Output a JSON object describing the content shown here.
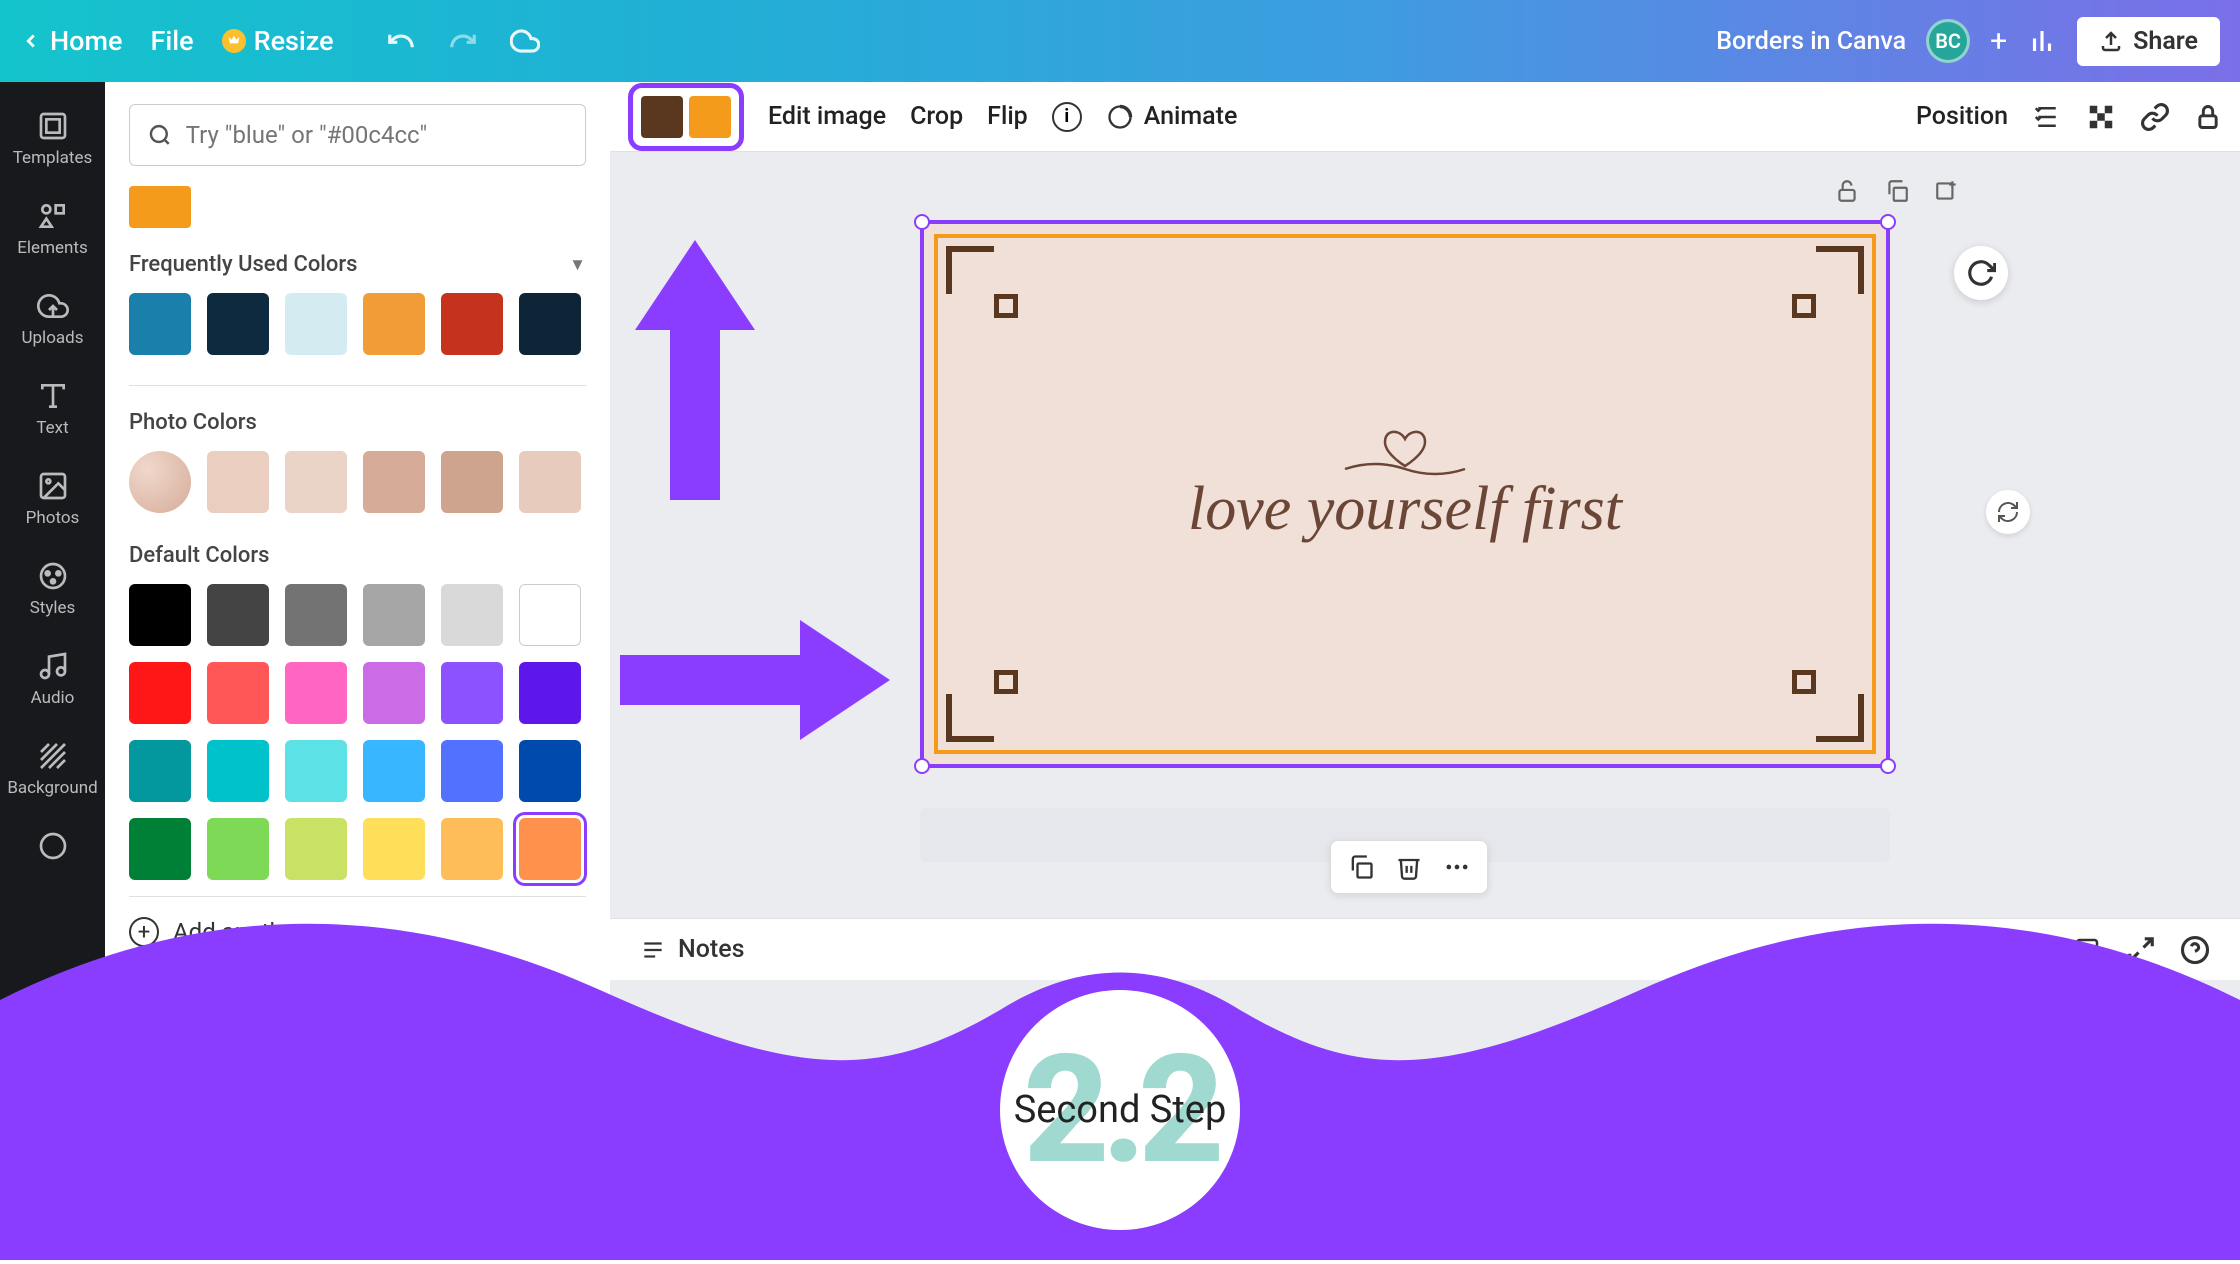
{
  "header": {
    "home": "Home",
    "file": "File",
    "resize": "Resize",
    "doc_title": "Borders in Canva",
    "avatar_initials": "BC",
    "share": "Share"
  },
  "rail": {
    "templates": "Templates",
    "elements": "Elements",
    "uploads": "Uploads",
    "text": "Text",
    "photos": "Photos",
    "styles": "Styles",
    "audio": "Audio",
    "background": "Background"
  },
  "panel": {
    "search_placeholder": "Try \"blue\" or \"#00c4cc\"",
    "freq_title": "Frequently Used Colors",
    "freq_colors": [
      "#1b7fab",
      "#0e2a3f",
      "#d4ecf1",
      "#f29c38",
      "#c5321e",
      "#0d2536"
    ],
    "photo_title": "Photo Colors",
    "photo_colors": [
      "#e5c9ba",
      "#eacfc1",
      "#ead3c7",
      "#d6ac99",
      "#cfa48e",
      "#e7cbbd"
    ],
    "default_title": "Default Colors",
    "default_rows": [
      [
        "#000000",
        "#444444",
        "#737373",
        "#a6a6a6",
        "#d9d9d9",
        "#ffffff"
      ],
      [
        "#ff1616",
        "#ff5757",
        "#ff66c4",
        "#cb6ce6",
        "#8c52ff",
        "#5e17eb"
      ],
      [
        "#03989e",
        "#00c2cb",
        "#5ce1e6",
        "#38b6ff",
        "#5271ff",
        "#004aad"
      ],
      [
        "#008037",
        "#7ed957",
        "#c9e265",
        "#ffde59",
        "#ffbd59",
        "#ff914d"
      ]
    ],
    "selected_default": "#ff914d",
    "add_another": "Add another"
  },
  "context": {
    "color1": "#5a3820",
    "color2": "#f59b1c",
    "edit_image": "Edit image",
    "crop": "Crop",
    "flip": "Flip",
    "animate": "Animate",
    "position": "Position"
  },
  "canvas": {
    "script_text": "love yourself first"
  },
  "bottom": {
    "notes": "Notes"
  },
  "overlay": {
    "step_number": "2.2",
    "step_label": "Second Step"
  }
}
